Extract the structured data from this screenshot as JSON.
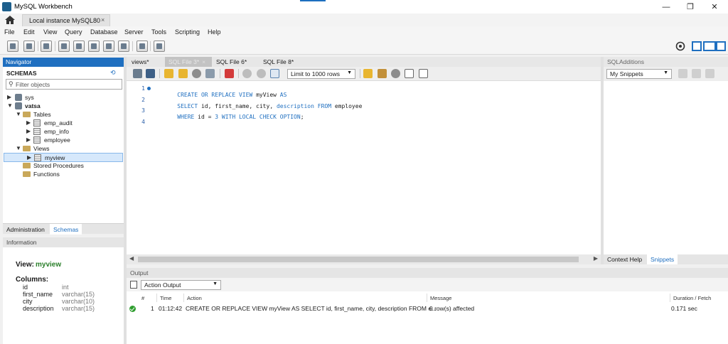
{
  "window": {
    "title": "MySQL Workbench",
    "controls": {
      "minimize": "—",
      "maximize": "❐",
      "close": "✕"
    }
  },
  "connection_tab": {
    "label": "Local instance MySQL80",
    "close": "×"
  },
  "menu": [
    "File",
    "Edit",
    "View",
    "Query",
    "Database",
    "Server",
    "Tools",
    "Scripting",
    "Help"
  ],
  "navigator": {
    "header": "Navigator",
    "schemas_label": "SCHEMAS",
    "filter_placeholder": "Filter objects",
    "tree": {
      "sys": "sys",
      "vatsa": "vatsa",
      "tables": "Tables",
      "table_items": [
        "emp_audit",
        "emp_info",
        "employee"
      ],
      "views": "Views",
      "view_items": [
        "myview"
      ],
      "stored_procedures": "Stored Procedures",
      "functions": "Functions"
    },
    "tabs": [
      "Administration",
      "Schemas"
    ]
  },
  "information": {
    "header": "Information",
    "view_label": "View:",
    "view_name": "myview",
    "columns_label": "Columns:",
    "columns": [
      {
        "name": "id",
        "type": "int"
      },
      {
        "name": "first_name",
        "type": "varchar(15)"
      },
      {
        "name": "city",
        "type": "varchar(10)"
      },
      {
        "name": "description",
        "type": "varchar(15)"
      }
    ]
  },
  "editor_tabs": [
    {
      "label": "views*",
      "active": false
    },
    {
      "label": "SQL File 3*",
      "active": true,
      "close": "×"
    },
    {
      "label": "SQL File 6*",
      "active": false
    },
    {
      "label": "SQL File 8*",
      "active": false
    }
  ],
  "editor_toolbar": {
    "limit_label": "Limit to 1000 rows"
  },
  "editor": {
    "lines": [
      {
        "num": "1",
        "parts": [
          [
            "kw",
            "CREATE OR REPLACE VIEW"
          ],
          [
            "",
            "myView"
          ],
          [
            "kw",
            " AS"
          ]
        ]
      },
      {
        "num": "2",
        "parts": [
          [
            "kw",
            "SELECT"
          ],
          [
            "",
            " id, first_name, city, "
          ],
          [
            "kw",
            "description"
          ],
          [
            "kw",
            " FROM"
          ],
          [
            "",
            " employee"
          ]
        ]
      },
      {
        "num": "3",
        "parts": [
          [
            "kw",
            "WHERE"
          ],
          [
            "",
            " id = "
          ],
          [
            "num",
            "3"
          ],
          [
            "kw",
            " WITH LOCAL CHECK OPTION"
          ],
          [
            "",
            ";"
          ]
        ]
      },
      {
        "num": "4",
        "parts": []
      }
    ]
  },
  "sql_additions": {
    "header": "SQLAdditions",
    "snippets_select": "My Snippets",
    "tabs": [
      "Context Help",
      "Snippets"
    ]
  },
  "output": {
    "header": "Output",
    "select": "Action Output",
    "columns": [
      "#",
      "Time",
      "Action",
      "Message",
      "Duration / Fetch"
    ],
    "rows": [
      {
        "status": "success",
        "num": "1",
        "time": "01:12:42",
        "action": "CREATE OR REPLACE VIEW myView AS SELECT id, first_name, city, description FROM e...",
        "message": "0 row(s) affected",
        "duration": "0.171 sec"
      }
    ]
  },
  "colors": {
    "accent": "#1f6fc0",
    "keyword": "#1f6fc0",
    "view_name": "#2a7f2a",
    "success": "#2e9d2e"
  }
}
